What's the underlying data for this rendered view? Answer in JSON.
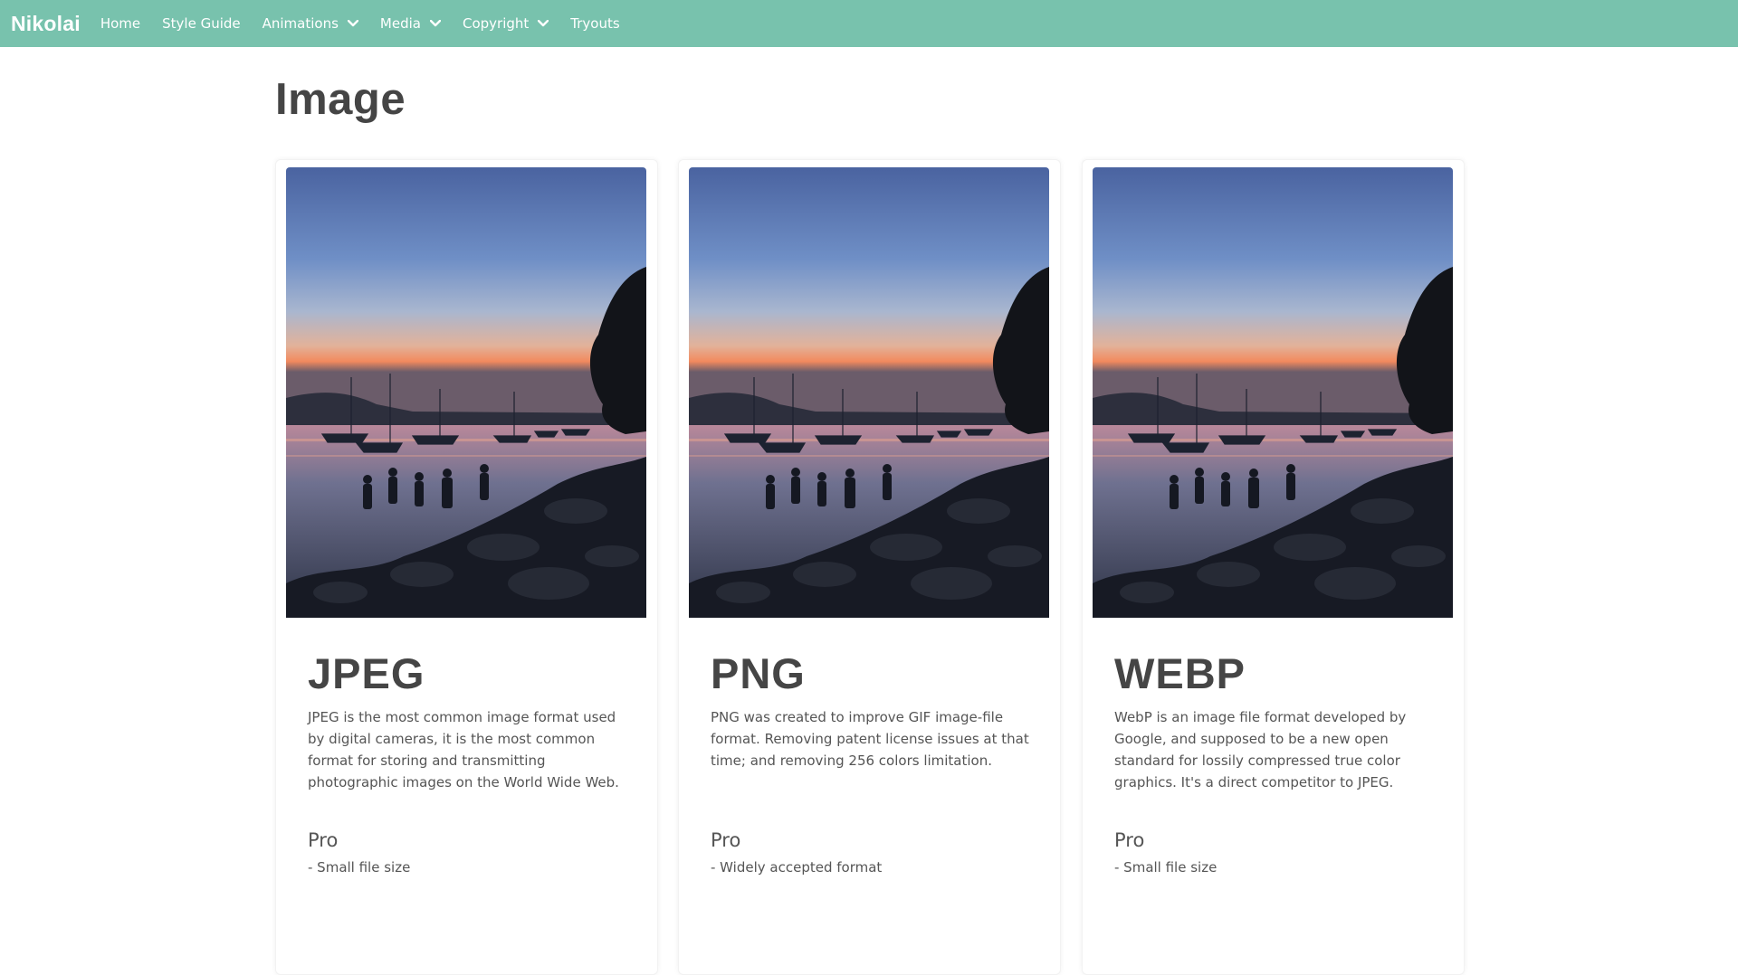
{
  "nav": {
    "brand": "Nikolai",
    "items": [
      {
        "label": "Home",
        "dropdown": false
      },
      {
        "label": "Style Guide",
        "dropdown": false
      },
      {
        "label": "Animations",
        "dropdown": true
      },
      {
        "label": "Media",
        "dropdown": true
      },
      {
        "label": "Copyright",
        "dropdown": true
      },
      {
        "label": "Tryouts",
        "dropdown": false
      }
    ],
    "bg_color": "#78c2ad"
  },
  "page": {
    "title": "Image"
  },
  "cards": [
    {
      "title": "JPEG",
      "description": "JPEG is the most common image format used by digital cameras, it is the most common format for storing and transmitting photographic images on the World Wide Web.",
      "pro_heading": "Pro",
      "pro_first": "- Small file size"
    },
    {
      "title": "PNG",
      "description": "PNG was created to improve GIF image-file format. Removing patent license issues at that time; and removing 256 colors limitation.",
      "pro_heading": "Pro",
      "pro_first": "- Widely accepted format"
    },
    {
      "title": "WEBP",
      "description": "WebP is an image file format developed by Google, and supposed to be a new open standard for lossily compressed true color graphics. It's a direct competitor to JPEG.",
      "pro_heading": "Pro",
      "pro_first": "- Small file size"
    }
  ]
}
